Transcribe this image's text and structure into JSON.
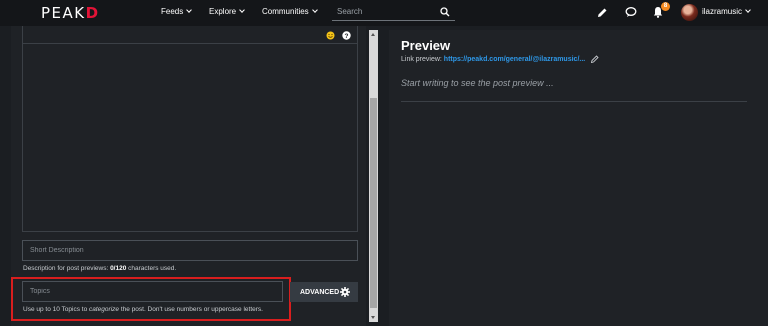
{
  "nav": {
    "logo_main": "PEAK",
    "logo_accent": "D",
    "links": [
      {
        "label": "Feeds"
      },
      {
        "label": "Explore"
      },
      {
        "label": "Communities"
      }
    ],
    "search_placeholder": "Search",
    "notification_count": "8",
    "username": "ilazramusic"
  },
  "editor": {
    "short_description_placeholder": "Short Description",
    "description_help_prefix": "Description for post previews: ",
    "description_help_count": "0/120",
    "description_help_suffix": " characters used.",
    "topics_placeholder": "Topics",
    "topics_help_prefix": "Use up to 10 Topics to ",
    "topics_help_em": "categorize",
    "topics_help_suffix": " the post. Don't use numbers or uppercase letters.",
    "advanced_label": "ADVANCED"
  },
  "preview": {
    "title": "Preview",
    "link_label": "Link preview: ",
    "link_url": "https://peakd.com/general/@ilazramusic/...",
    "placeholder": "Start writing to see the post preview ..."
  },
  "colors": {
    "accent_red": "#e31337",
    "link_blue": "#2e98e8",
    "badge_orange": "#f68a1f",
    "highlight_red": "#d81e1e"
  }
}
